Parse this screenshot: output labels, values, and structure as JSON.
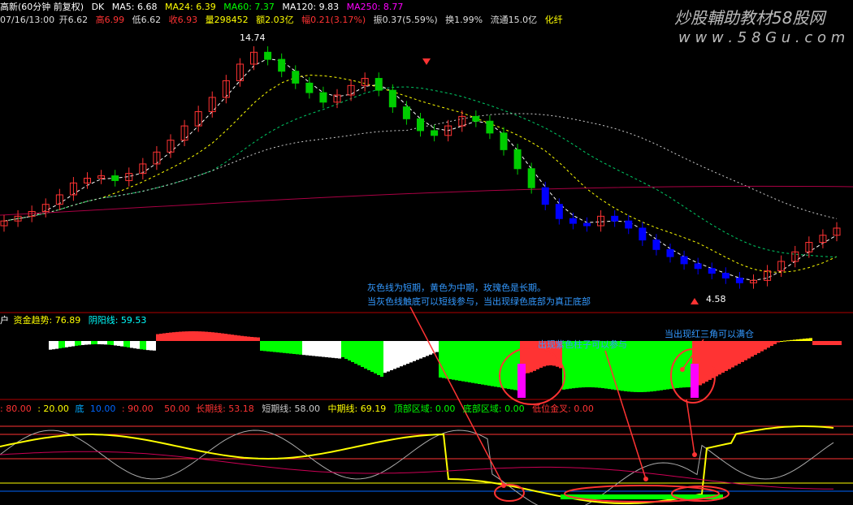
{
  "header": {
    "title": "高新(60分钟 前复权)",
    "dk": "DK",
    "ma5": "MA5: 6.68",
    "ma24": "MA24: 6.39",
    "ma60": "MA60: 7.37",
    "ma120": "MA120: 9.83",
    "ma250": "MA250: 8.77",
    "date": "07/16/13:00",
    "open": "开6.62",
    "high": "高6.99",
    "low": "低6.62",
    "close": "收6.93",
    "volume": "量298452",
    "amount": "额2.03亿",
    "pct": "幅0.21(3.17%)",
    "amplitude": "振0.37(5.59%)",
    "turnover": "换1.99%",
    "float": "流通15.0亿",
    "industry": "化纤"
  },
  "watermark": {
    "brand": "炒股輔助教材58股网",
    "url": "w w w . 5 8 G u . c o m"
  },
  "price_labels": {
    "high_mark": "14.74",
    "low_mark": "4.58"
  },
  "panel2": {
    "prefix": "户",
    "trend_label": "资金趋势: 76.89",
    "yinyang_label": "阴阳线: 59.53"
  },
  "panel3": {
    "l80": ": 80.00",
    "l20": ": 20.00",
    "di": "底",
    "l10": "10.00",
    "l90": ": 90.00",
    "l50": "50.00",
    "long": "长期线: 53.18",
    "short": "短期线: 58.00",
    "mid": "中期线: 69.19",
    "top_zone": "顶部区域: 0.00",
    "bottom_zone": "底部区域: 0.00",
    "cross": "低位金叉: 0.00"
  },
  "annotations": {
    "a1": "灰色线为短期，黄色为中期，玫瑰色是长期。",
    "a2": "当灰色线触底可以短线参与，当出现绿色底部为真正底部",
    "a3": "出现紫色柱子可以参与",
    "a4": "当出现红三角可以满仓"
  },
  "colors": {
    "up": "#ff3333",
    "down_green": "#00cc00",
    "down_blue": "#0000ff",
    "yellow": "#ffff00",
    "magenta": "#ff00ff"
  },
  "chart_data": [
    {
      "type": "candlestick",
      "title": "高新(60分钟 前复权)",
      "series": [
        {
          "name": "MA5",
          "current": 6.68
        },
        {
          "name": "MA24",
          "current": 6.39
        },
        {
          "name": "MA60",
          "current": 7.37
        },
        {
          "name": "MA120",
          "current": 9.83
        },
        {
          "name": "MA250",
          "current": 8.77
        }
      ],
      "high_marked": 14.74,
      "low_marked": 4.58,
      "close": [
        7.2,
        7.4,
        7.6,
        7.9,
        8.3,
        8.8,
        9.0,
        9.1,
        8.9,
        9.2,
        9.6,
        10.1,
        10.6,
        11.2,
        11.8,
        12.4,
        13.1,
        13.8,
        14.3,
        14.0,
        13.5,
        13.0,
        12.6,
        12.2,
        12.5,
        12.9,
        13.2,
        12.7,
        12.0,
        11.5,
        11.0,
        10.8,
        11.2,
        11.6,
        11.4,
        10.9,
        10.2,
        9.4,
        8.6,
        7.9,
        7.3,
        7.1,
        7.0,
        7.4,
        7.2,
        6.9,
        6.4,
        6.0,
        5.7,
        5.4,
        5.2,
        5.0,
        4.8,
        4.6,
        4.7,
        5.1,
        5.5,
        5.9,
        6.3,
        6.6,
        6.9
      ]
    },
    {
      "type": "bar",
      "title": "资金趋势",
      "series": [
        {
          "name": "资金趋势",
          "current": 76.89
        },
        {
          "name": "阴阳线",
          "current": 59.53
        }
      ]
    },
    {
      "type": "line",
      "series": [
        {
          "name": "长期线",
          "current": 53.18
        },
        {
          "name": "短期线",
          "current": 58.0
        },
        {
          "name": "中期线",
          "current": 69.19
        }
      ],
      "levels": [
        80,
        20,
        10,
        90,
        50
      ]
    }
  ]
}
